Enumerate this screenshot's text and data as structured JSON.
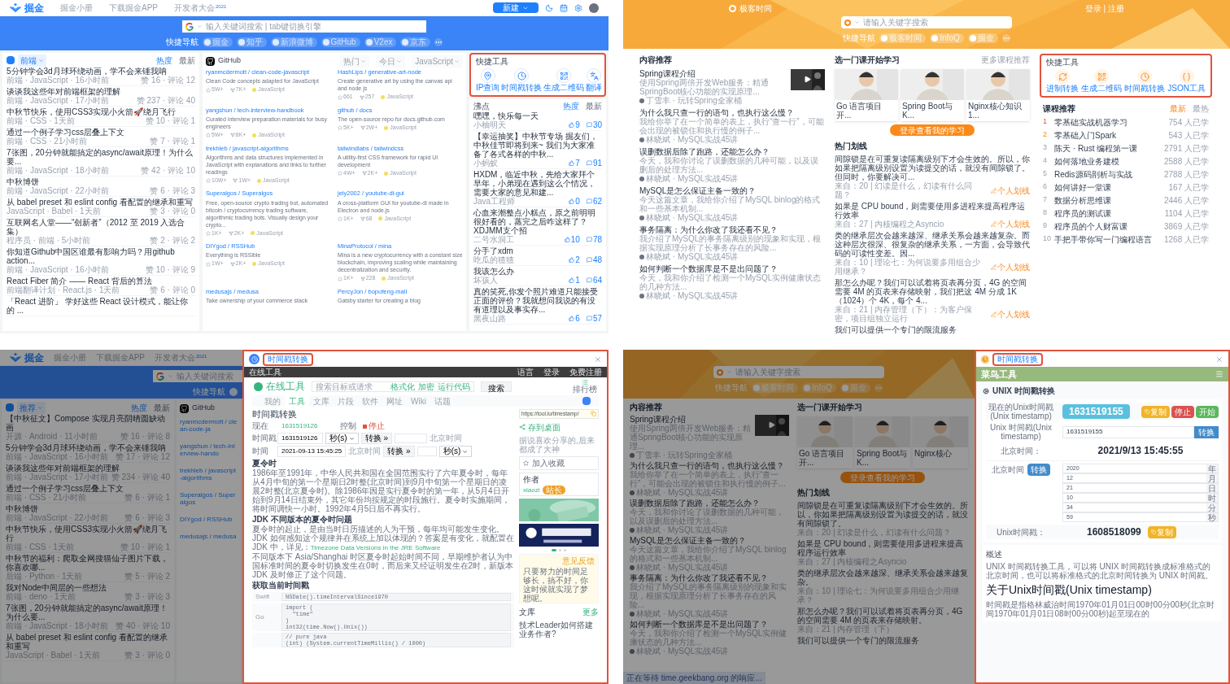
{
  "juejin_page": {
    "nav": {
      "logo": "掘金",
      "links": [
        {
          "label": "掘金小册"
        },
        {
          "label": "下载掘金APP"
        },
        {
          "label": "开发者大会",
          "sup": "2021"
        }
      ],
      "new_button": "新建"
    },
    "search": {
      "placeholder": "输入关键词搜索 | tab键切换引擎"
    },
    "quick_nav": {
      "label": "快捷导航",
      "items": [
        "掘金",
        "知乎",
        "新浪微博",
        "GitHub",
        "V2ex",
        "京东"
      ]
    },
    "feed": {
      "category": "前端",
      "tabs": [
        {
          "label": "热度",
          "selected": true
        },
        {
          "label": "最新",
          "selected": false
        }
      ],
      "articles": [
        {
          "title": "5分钟学会3d月球环绕动画，学不会来锤我呐",
          "meta": "前端 · JavaScript · 16小时前",
          "stats": "赞 16 · 评论 12"
        },
        {
          "title": "谈谈我这些年对前端框架的理解",
          "meta": "前端 · JavaScript · 17小时前",
          "stats": "赞 237 · 评论 40"
        },
        {
          "title": "中秋节快乐，使用CSS3实现小火箭🚀绕月飞行",
          "meta": "前端 · CSS · 1天前",
          "stats": "赞 10 · 评论 1"
        },
        {
          "title": "通过一个例子学习css层叠上下文",
          "meta": "前端 · CSS · 21小时前",
          "stats": "赞 7 · 评论 1"
        },
        {
          "title": "7张图，20分钟就能搞定的async/await原理！为什么要...",
          "meta": "前端 · JavaScript · 18小时前",
          "stats": "赞 42 · 评论 10"
        },
        {
          "title": "中秋博饼",
          "meta": "前端 · JavaScript · 22小时前",
          "stats": "赞 6 · 评论 3"
        },
        {
          "title": "从 babel preset 和 eslint config 看配置的继承和重写",
          "meta": "JavaScript · Babel · 1天前",
          "stats": "赞 3 · 评论 0"
        },
        {
          "title": "互联网名人堂——“创新者”（2012 至 2019 入选合集）",
          "meta": "程序员 · 前端 · 5小时前",
          "stats": "赞 2 · 评论 2"
        },
        {
          "title": "你知道Github中国区谁最有影响力吗？用github action...",
          "meta": "前端 · JavaScript · 16小时前",
          "stats": "赞 10 · 评论 9"
        },
        {
          "title": "React Fiber 简介 —— React 背后的算法",
          "meta": "前端翻译计划 · React.js · 1天前",
          "stats": "赞 6 · 评论 0"
        },
        {
          "title": "「React 进阶」 学好这些 React 设计模式，能让你的 ..."
        }
      ]
    },
    "github": {
      "title": "GitHub",
      "filters": [
        "热门",
        "今日",
        "JavaScript"
      ],
      "repos": [
        {
          "name": "ryanmcdermott / clean-code-javascript",
          "description": "Clean Code concepts adapted for JavaScript",
          "stars": "5W+",
          "forks": "7K+",
          "language": "JavaScript"
        },
        {
          "name": "HashLips / generative-art-node",
          "description": "Create generative art by using the canvas api and node js",
          "stars": "661",
          "forks": "257",
          "language": "JavaScript"
        },
        {
          "name": "yangshun / tech-interview-handbook",
          "description": "Curated interview preparation materials for busy engineers",
          "stars": "5W+",
          "forks": "8K+",
          "language": "JavaScript"
        },
        {
          "name": "github / docs",
          "description": "The open-source repo for docs.github.com",
          "stars": "5K+",
          "forks": "2W+",
          "language": "JavaScript"
        },
        {
          "name": "trekhleb / javascript-algorithms",
          "description": "Algorithms and data structures implemented in JavaScript with explanations and links to further readings",
          "stars": "10W+",
          "forks": "1W+",
          "language": "JavaScript"
        },
        {
          "name": "tailwindlabs / tailwindcss",
          "description": "A utility-first CSS framework for rapid UI development",
          "stars": "4W+",
          "forks": "2K+",
          "language": "JavaScript"
        },
        {
          "name": "Superalgos / Superalgos",
          "description": "Free, open-source crypto trading bot, automated bitcoin / cryptocurrency trading software, algorithmic trading bots. Visually design your crypto...",
          "stars": "1K+",
          "forks": "2K+",
          "language": "JavaScript"
        },
        {
          "name": "jely2002 / youtube-dl-gui",
          "description": "A cross-platform GUI for youtube-dl made in Electron and node.js",
          "stars": "1K+",
          "forks": "68",
          "language": "JavaScript"
        },
        {
          "name": "DIYgod / RSSHub",
          "description": "Everything is RSSible",
          "stars": "1W+",
          "forks": "2K+",
          "language": "JavaScript"
        },
        {
          "name": "MinaProtocol / mina",
          "description": "Mina is a new cryptocurrency with a constant size blockchain, improving scaling while maintaining decentralization and security.",
          "stars": "1K+",
          "forks": "228",
          "language": "JavaScript"
        },
        {
          "name": "medusajs / medusa",
          "description": "Take ownership of your commerce stack"
        },
        {
          "name": "PercyJon / bopufeng-mall",
          "description": "Gatsby starter for creating a blog"
        }
      ]
    },
    "tools": {
      "title": "快捷工具",
      "highlighted": true,
      "items": [
        {
          "label": "IP查询",
          "kind": "pin"
        },
        {
          "label": "时间戳转换",
          "kind": "clock"
        },
        {
          "label": "生成二维码",
          "kind": "qr"
        },
        {
          "label": "翻译",
          "kind": "translate"
        }
      ]
    },
    "pins": {
      "title": "沸点",
      "tabs": [
        {
          "label": "热度",
          "selected": true
        },
        {
          "label": "最新",
          "selected": false
        }
      ],
      "posts": [
        {
          "text": "嘿嘿，快乐每一天",
          "author": "小柚明天",
          "likes": "9",
          "comments": "30"
        },
        {
          "text": "【幸运抽奖】中秋节专场 掘友们，中秋佳节即将到来~ 我们为大家准备了各式各样的中秋...",
          "author": "小蚂蚁",
          "likes": "7",
          "comments": "91"
        },
        {
          "text": "HXDM，临近中秋，先给大家拜个早年，小弟现在遇到这么个情况，需要大家的意见和建...",
          "author": "Java工程师",
          "likes": "0",
          "comments": "62"
        },
        {
          "text": "心血来潮整点小糕点，原之前明明很好看的，蒸完之后咋这样了？XDJMM支个招",
          "author": "二号水洞工",
          "likes": "10",
          "comments": "78"
        },
        {
          "text": "分手了xdm",
          "author": "吃瓜的猹猹",
          "likes": "2",
          "comments": "48"
        },
        {
          "text": "我该怎么办",
          "author": "坏孩人",
          "likes": "1",
          "comments": "64"
        },
        {
          "text": "真的笑死,你发个照片难道只能接受正面的评价？我就想问我说的有没有道理以及事实存...",
          "author": "黑夜山路",
          "likes": "6",
          "comments": "57"
        }
      ]
    }
  },
  "geekbang_page": {
    "logo": "极客时间",
    "auth": "登录 | 注册",
    "search": {
      "placeholder": "请输入关键字搜索"
    },
    "quick_nav": {
      "label": "快捷导航",
      "items": [
        "极客时间",
        "InfoQ",
        "掘金"
      ]
    },
    "recommend": {
      "title": "内容推荐",
      "items": [
        {
          "kind": "video",
          "title": "Spring课程介绍",
          "summary": "使用Spring两倍开发Web服务：精通SpringBoot核心功能的实现原理...",
          "author": "丁雪丰 · 玩转Spring全家桶"
        },
        {
          "kind": "text",
          "title": "为什么我只查一行的语句，也执行这么慢？",
          "summary": "我给你举了在一个简单的表上，执行“查一行”，可能会出现的被锁住和执行慢的例子...",
          "author": "林晓斌 · MySQL实战45讲"
        },
        {
          "kind": "text",
          "title": "误删数据后除了跑路，还能怎么办？",
          "summary": "今天，我和你讨论了误删数据的几种可能，以及误删后的处理方法...",
          "author": "林晓斌 · MySQL实战45讲"
        },
        {
          "kind": "text",
          "title": "MySQL是怎么保证主备一致的？",
          "summary": "今天这篇文章，我给你介绍了MySQL binlog的格式和一些基本机制...",
          "author": "林晓斌 · MySQL实战45讲"
        },
        {
          "kind": "text",
          "title": "事务隔离：为什么你改了我还看不见？",
          "summary": "我介绍了MySQL的事务隔离级别的现象和实现，根据实现原理分析了长事务存在的风险...",
          "author": "林晓斌 · MySQL实战45讲"
        },
        {
          "kind": "text",
          "title": "如何判断一个数据库是不是出问题了？",
          "summary": "今天，我和你介绍了检测一个MySQL实例健康状态的几种方法...",
          "author": "林晓斌 · MySQL实战45讲"
        }
      ]
    },
    "courses": {
      "title": "选一门课开始学习",
      "more": "更多课程推荐",
      "items": [
        {
          "title": "Go 语言项目开..."
        },
        {
          "title": "Spring Boot与K..."
        },
        {
          "title": "Nginx核心知识1..."
        }
      ],
      "button": "登录查看我的学习"
    },
    "highlights": {
      "title": "热门划线",
      "items": [
        {
          "text": "间隙锁是在可重复读隔离级别下才会生效的。所以，你如果把隔离级别设置为读提交的话，就没有间隙锁了。但同时，你要解决可...",
          "source": "来自：20 | 幻读是什么，幻读有什么问题？",
          "action": "个人划线"
        },
        {
          "text": "如果是 CPU bound，则需要使用多进程来提高程序运行效率",
          "source": "来自：27 | 内核编程之Asyncio",
          "action": "个人划线"
        },
        {
          "text": "类的继承层次会越来越深、继承关系会越来越复杂。而这种层次很深、很复杂的继承关系，一方面，会导致代码的可读性变差。因...",
          "source": "来自：10 | 理论七：为何说要多用组合少用继承？",
          "action": "个人划线"
        },
        {
          "text": "那怎么办呢？我们可以试着将页表再分页，4G 的空间需要 4M 的页表来存储映射，我们把这 4M 分成 1K（1024）个 4K，每个 4...",
          "source": "来自：21 | 内存管理（下）：为客户保密，项目组独立运行",
          "action": "个人划线"
        },
        {
          "text": "我们可以提供一个专门的限流服务"
        }
      ]
    },
    "tools": {
      "title": "快捷工具",
      "highlighted": true,
      "items": [
        {
          "label": "进制转换",
          "kind": "convert"
        },
        {
          "label": "生成二维码",
          "kind": "qr"
        },
        {
          "label": "时间戳转换",
          "kind": "clock"
        },
        {
          "label": "JSON工具",
          "kind": "json"
        }
      ]
    },
    "ranking": {
      "title": "课程推荐",
      "tabs": [
        {
          "label": "最新",
          "selected": true
        },
        {
          "label": "最热",
          "selected": false
        }
      ],
      "items": [
        {
          "rank": "1",
          "title": "零基础实战机器学习",
          "count": "754 人已学"
        },
        {
          "rank": "2",
          "title": "零基础入门Spark",
          "count": "543 人已学"
        },
        {
          "rank": "3",
          "title": "陈天 · Rust 编程第一课",
          "count": "2791 人已学"
        },
        {
          "rank": "4",
          "title": "如何落地业务建模",
          "count": "2588 人已学"
        },
        {
          "rank": "5",
          "title": "Redis源码剖析与实战",
          "count": "2788 人已学"
        },
        {
          "rank": "6",
          "title": "如何讲好一堂课",
          "count": "167 人已学"
        },
        {
          "rank": "7",
          "title": "数据分析思维课",
          "count": "2446 人已学"
        },
        {
          "rank": "8",
          "title": "程序员的测试课",
          "count": "1104 人已学"
        },
        {
          "rank": "9",
          "title": "程序员的个人财富课",
          "count": "3869 人已学"
        },
        {
          "rank": "10",
          "title": "手把手带你写一门编程语言",
          "count": "1268 人已学"
        }
      ]
    }
  },
  "tool_lu_screen": {
    "background": {
      "nav": {
        "logo": "掘金",
        "links": [
          {
            "label": "掘金小册"
          },
          {
            "label": "下载掘金APP"
          },
          {
            "label": "开发者大会",
            "sup": "2021"
          }
        ]
      },
      "search": {
        "placeholder": "输入关键词搜索"
      },
      "quick_nav": {
        "label": "快捷导航"
      },
      "feed": {
        "category": "推荐",
        "tabs": [
          {
            "label": "热度",
            "selected": true
          },
          {
            "label": "最新",
            "selected": false
          }
        ],
        "articles": [
          {
            "title": "【中秋征文】Compose 实现月亮阴晴圆缺动画",
            "meta": "开源 · Android · 11小时前",
            "stats": "赞 16 · 评论 8"
          },
          {
            "title": "5分钟学会3d月球环绕动画，学不会来锤我呐",
            "meta": "前端 · JavaScript · 16小时前",
            "stats": "赞 17 · 评论 12"
          },
          {
            "title": "谈谈我这些年对前端框架的理解",
            "meta": "前端 · JavaScript · 17小时前",
            "stats": "赞 234 · 评论 40"
          },
          {
            "title": "通过一个例子学习css层叠上下文",
            "meta": "前端 · CSS · 21小时前",
            "stats": "赞 6 · 评论 1"
          },
          {
            "title": "中秋博饼",
            "meta": "前端 · JavaScript · 22小时前",
            "stats": "赞 6 · 评论 3"
          },
          {
            "title": "中秋节快乐，使用CSS3实现小火箭🚀绕月飞行",
            "meta": "前端 · CSS · 1天前",
            "stats": "赞 10 · 评论 1"
          },
          {
            "title": "中秋节的福利：爬取全网搜猫仙子图片下载，你喜欢哪...",
            "meta": "后端 · Python · 1天前",
            "stats": "赞 5 · 评论 2"
          },
          {
            "title": "我对Node中间层的一些想法",
            "meta": "前端 · deno · 1天前",
            "stats": "赞 3 · 评论 3"
          },
          {
            "title": "7张图，20分钟就能搞定的async/await原理！为什么要...",
            "meta": "前端 · JavaScript · 18小时前",
            "stats": "赞 40 · 评论 10"
          },
          {
            "title": "从 babel preset 和 eslint config 看配置的继承和重写",
            "meta": "JavaScript · Babel · 1天前",
            "stats": "赞 3 · 评论 0"
          }
        ]
      },
      "github": {
        "title": "GitHub",
        "repos": [
          {
            "name": "ryanmcdermott / clean-code-ja"
          },
          {
            "name": "yangshun / tech-interview-hando"
          },
          {
            "name": "trekhleb / javascript-algorithms"
          },
          {
            "name": "Superalgos / Superalgos"
          },
          {
            "name": "DIYgod / RSSHub"
          },
          {
            "name": "medusajs / medusa"
          }
        ]
      }
    },
    "dialog": {
      "title": "时间戳转换",
      "highlighted": true,
      "site_bar": {
        "name": "在线工具",
        "links": [
          "语言",
          "登录",
          "免费注册"
        ]
      },
      "logo": "在线工具",
      "search": {
        "placeholder": "搜索目标或请求",
        "links": [
          "格式化",
          "加密",
          "运行代码"
        ],
        "button": "搜索"
      },
      "rank_link": "排行榜",
      "tabs": [
        {
          "label": "我的",
          "selected": false
        },
        {
          "label": "工具",
          "selected": true
        },
        {
          "label": "文库",
          "selected": false
        },
        {
          "label": "片段",
          "selected": false
        },
        {
          "label": "软件",
          "selected": false
        },
        {
          "label": "网址",
          "selected": false
        },
        {
          "label": "Wiki",
          "selected": false
        },
        {
          "label": "话题",
          "selected": false
        }
      ],
      "heading": "时间戳转换",
      "now": {
        "label": "现在",
        "value": "1631519126",
        "control_label": "控制",
        "control": "停止"
      },
      "to_time": {
        "label": "时间戳",
        "value": "1631519126",
        "unit": "秒(s)",
        "button": "转换 »",
        "result_label": "北京时间"
      },
      "to_stamp": {
        "label": "时间",
        "value": "2021-09-13 15:45:25",
        "zone": "北京时间",
        "button": "转换 »",
        "unit": "秒(s)"
      },
      "sections": [
        {
          "heading": "夏令时",
          "paragraphs": [
            "1986年至1991年，中华人民共和国在全国范围实行了六年夏令时，每年从4月中旬的第一个星期日2时整(北京时间)到9月中旬第一个星期日的凌晨2时整(北京夏令时)。除1986年因是实行夏令时的第一年，从5月4日开始到9月14日结束外，其它年份均按规定的时段施行。夏令时实施期间，将时间调快一小时。1992年4月5日后不再实行。"
          ]
        },
        {
          "heading": "JDK 不同版本的夏令时问题",
          "paragraphs": [
            "夏令时的起止，是由当时日历描述的人为干预，每年均可能发生变化。JDK 如何感知这个规律并在系统上加以体现的？答案是有变化，就配置在 JDK 中，详见：",
            "不同版本下 Asia/Shanghai 时区夏令时起始时间不同，早期维护者认为中国标准时间的夏令时切换发生在0时，而后来又经证明发生在2时，新版本 JDK 及时修正了这个问题。"
          ],
          "link": "Timezone Data Versions in the JRE Software"
        },
        {
          "heading": "获取当前时间戳"
        }
      ],
      "code": [
        {
          "language": "Swift",
          "code": "NSDate().timeIntervalSince1970"
        },
        {
          "language": "Go",
          "code": "import (\n  \"time\"\n)\nint32(time.Now().Unix())"
        },
        {
          "code": "// pure java\n(int) (System.currentTimeMillis() / 1000)"
        }
      ],
      "side": {
        "url": "https://tool.lu/timestamp/",
        "save": "存到桌面",
        "share_note": "据说喜欢分享的,后来都成了大神",
        "favorite": "加入收藏",
        "author_title": "作者",
        "author": "xiaozi",
        "author_badge": "站长",
        "tip": "只要努力的时间足够长，搞不好，你这时候就实现了梦想呢。",
        "tip_label": "意见反馈",
        "library": "文库",
        "library_more": "更多",
        "library_items": [
          "技术Leader如何搭建业务作者?"
        ]
      }
    }
  },
  "runoob_screen": {
    "background": {
      "search": {
        "placeholder": "请输入关键字搜索"
      },
      "quick_nav": {
        "label": "快捷导航",
        "items": [
          "极客时间",
          "InfoQ",
          "掘金"
        ]
      },
      "recommend": {
        "title": "内容推荐",
        "items": [
          {
            "kind": "video",
            "title": "Spring课程介绍",
            "summary": "使用Spring两倍开发Web服务：精通SpringBoot核心功能的实现原理...",
            "author": "丁雪丰 · 玩转Spring全家桶"
          },
          {
            "kind": "text",
            "title": "为什么我只查一行的语句，也执行这么慢？",
            "summary": "我给你举了在一个简单的表上，执行“查一行”，可能会出现的被锁住和执行慢的例子...",
            "author": "林晓斌 · MySQL实战45讲"
          },
          {
            "kind": "text",
            "title": "误删数据后除了跑路，还能怎么办？",
            "summary": "今天，我和你讨论了误删数据的几种可能，以及误删后的处理方法...",
            "author": "林晓斌 · MySQL实战45讲"
          },
          {
            "kind": "text",
            "title": "MySQL是怎么保证主备一致的？",
            "summary": "今天这篇文章，我给你介绍了MySQL binlog的格式和一些基本机制...",
            "author": "林晓斌 · MySQL实战45讲"
          },
          {
            "kind": "text",
            "title": "事务隔离：为什么你改了我还看不见？",
            "summary": "我介绍了MySQL的事务隔离级别的现象和实现，根据实现原理分析了长事务存在的风险...",
            "author": "林晓斌 · MySQL实战45讲"
          },
          {
            "kind": "text",
            "title": "如何判断一个数据库是不是出问题了？",
            "summary": "今天，我和你介绍了检测一个MySQL实例健康状态的几种方法...",
            "author": "林晓斌 · MySQL实战45讲"
          }
        ]
      },
      "courses": {
        "title": "选一门课开始学习",
        "items": [
          {
            "title": "Go 语言项目开..."
          },
          {
            "title": "Spring Boot与K..."
          },
          {
            "title": "Nginx核心"
          }
        ],
        "button": "登录查看我的学习"
      },
      "highlights": {
        "title": "热门划线",
        "items": [
          {
            "text": "间隙锁是在可重复读隔离级别下才会生效的。所以，你如果把隔离级别设置为读提交的话，就没有间隙锁了。",
            "source": "来自：20 | 幻读是什么，幻读有什么问题？"
          },
          {
            "text": "如果是 CPU bound，则需要使用多进程来提高程序运行效率",
            "source": "来自：27 | 内核编程之Asyncio"
          },
          {
            "text": "类的继承层次会越来越深、继承关系会越来越复杂。",
            "source": "来自：10 | 理论七：为何说要多用组合少用继承？"
          },
          {
            "text": "那怎么办呢？我们可以试着将页表再分页，4G 的空间需要 4M 的页表来存储映射。",
            "source": "来自：21 | 内存管理（下）"
          },
          {
            "text": "我们可以提供一个专门的限流服务"
          }
        ]
      },
      "status": "正在等待 time.geekbang.org 的响应..."
    },
    "dialog": {
      "title": "时间戳转换",
      "highlighted": true,
      "site": "菜鸟工具",
      "heading": "UNIX 时间戳转换",
      "now": {
        "label": "现在的Unix时间戳(Unix timestamp)",
        "value": "1631519155",
        "buttons": [
          {
            "label": "复制",
            "kind": "copy"
          },
          {
            "label": "停止",
            "kind": "stop"
          },
          {
            "label": "开始",
            "kind": "start"
          }
        ]
      },
      "to_time": {
        "label": "Unix 时间戳(Unix timestamp)",
        "value": "1631519155",
        "button": "转换",
        "result_label": "北京时间：",
        "result": "2021/9/13 15:45:55"
      },
      "to_stamp": {
        "label": "北京时间",
        "button": "转换",
        "fields": [
          {
            "value": "2020",
            "unit": "年"
          },
          {
            "value": "12",
            "unit": "月"
          },
          {
            "value": "21",
            "unit": "日"
          },
          {
            "value": "10",
            "unit": "时"
          },
          {
            "value": "34",
            "unit": "分"
          },
          {
            "value": "59",
            "unit": "秒"
          }
        ],
        "result_label": "Unix时间戳：",
        "result": "1608518099",
        "copy": "复制"
      },
      "overview_title": "概述",
      "overview": "UNIX 时间戳转换工具，可以将 UNIX 时间戳转换成标准格式的北京时间，也可以将标准格式的北京时间转换为 UNIX 时间戳。",
      "about_title": "关于Unix时间戳(Unix timestamp)",
      "about": "时间戳是指格林威治时间1970年01月01日00时00分00秒(北京时间1970年01月01日08时00分00秒)起至现在的"
    }
  }
}
